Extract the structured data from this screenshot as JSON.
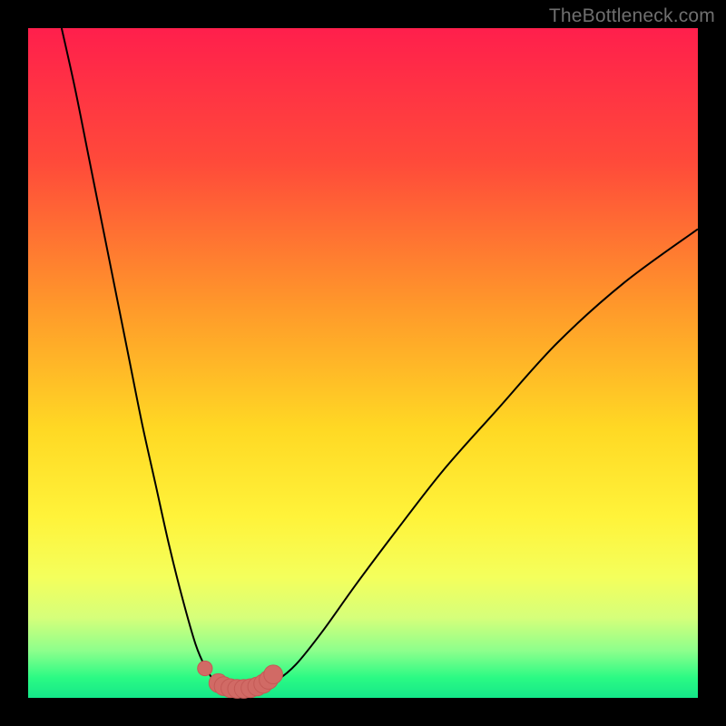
{
  "watermark": "TheBottleneck.com",
  "colors": {
    "frame": "#000000",
    "gradient_stops": [
      {
        "pct": 0,
        "color": "#ff1f4c"
      },
      {
        "pct": 20,
        "color": "#ff4a3a"
      },
      {
        "pct": 42,
        "color": "#ff9a2a"
      },
      {
        "pct": 60,
        "color": "#ffd924"
      },
      {
        "pct": 73,
        "color": "#fff33a"
      },
      {
        "pct": 82,
        "color": "#f4ff5c"
      },
      {
        "pct": 88,
        "color": "#d6ff7a"
      },
      {
        "pct": 93,
        "color": "#8cff8c"
      },
      {
        "pct": 97,
        "color": "#2bfa84"
      },
      {
        "pct": 100,
        "color": "#14e789"
      }
    ],
    "curve_stroke": "#000000",
    "marker_fill": "#d16a65",
    "marker_stroke": "#c45a56"
  },
  "chart_data": {
    "type": "line",
    "title": "",
    "xlabel": "",
    "ylabel": "",
    "xlim": [
      0,
      100
    ],
    "ylim": [
      0,
      100
    ],
    "grid": false,
    "series": [
      {
        "name": "left-curve",
        "x": [
          5,
          7,
          9,
          11,
          13,
          15,
          17,
          19,
          21,
          23,
          25,
          26.5,
          28,
          29
        ],
        "y": [
          100,
          91,
          81,
          71,
          61,
          51,
          41,
          32,
          23,
          15,
          8,
          4.5,
          2.3,
          1.7
        ]
      },
      {
        "name": "right-curve",
        "x": [
          35,
          37,
          40,
          44,
          49,
          55,
          62,
          70,
          79,
          89,
          100
        ],
        "y": [
          1.7,
          2.5,
          5,
          10,
          17,
          25,
          34,
          43,
          53,
          62,
          70
        ]
      },
      {
        "name": "floor",
        "x": [
          29,
          30,
          31,
          32,
          33,
          34,
          35
        ],
        "y": [
          1.7,
          1.4,
          1.3,
          1.3,
          1.3,
          1.4,
          1.7
        ]
      }
    ],
    "markers": {
      "name": "highlighted-points",
      "points": [
        {
          "x": 26.4,
          "y": 4.4,
          "r": 1.1
        },
        {
          "x": 28.4,
          "y": 2.2,
          "r": 1.4
        },
        {
          "x": 29.2,
          "y": 1.75,
          "r": 1.4
        },
        {
          "x": 30.2,
          "y": 1.45,
          "r": 1.4
        },
        {
          "x": 31.2,
          "y": 1.35,
          "r": 1.4
        },
        {
          "x": 32.2,
          "y": 1.35,
          "r": 1.4
        },
        {
          "x": 33.2,
          "y": 1.45,
          "r": 1.4
        },
        {
          "x": 34.2,
          "y": 1.7,
          "r": 1.4
        },
        {
          "x": 35.1,
          "y": 2.1,
          "r": 1.4
        },
        {
          "x": 35.9,
          "y": 2.7,
          "r": 1.4
        },
        {
          "x": 36.6,
          "y": 3.5,
          "r": 1.4
        }
      ]
    }
  }
}
